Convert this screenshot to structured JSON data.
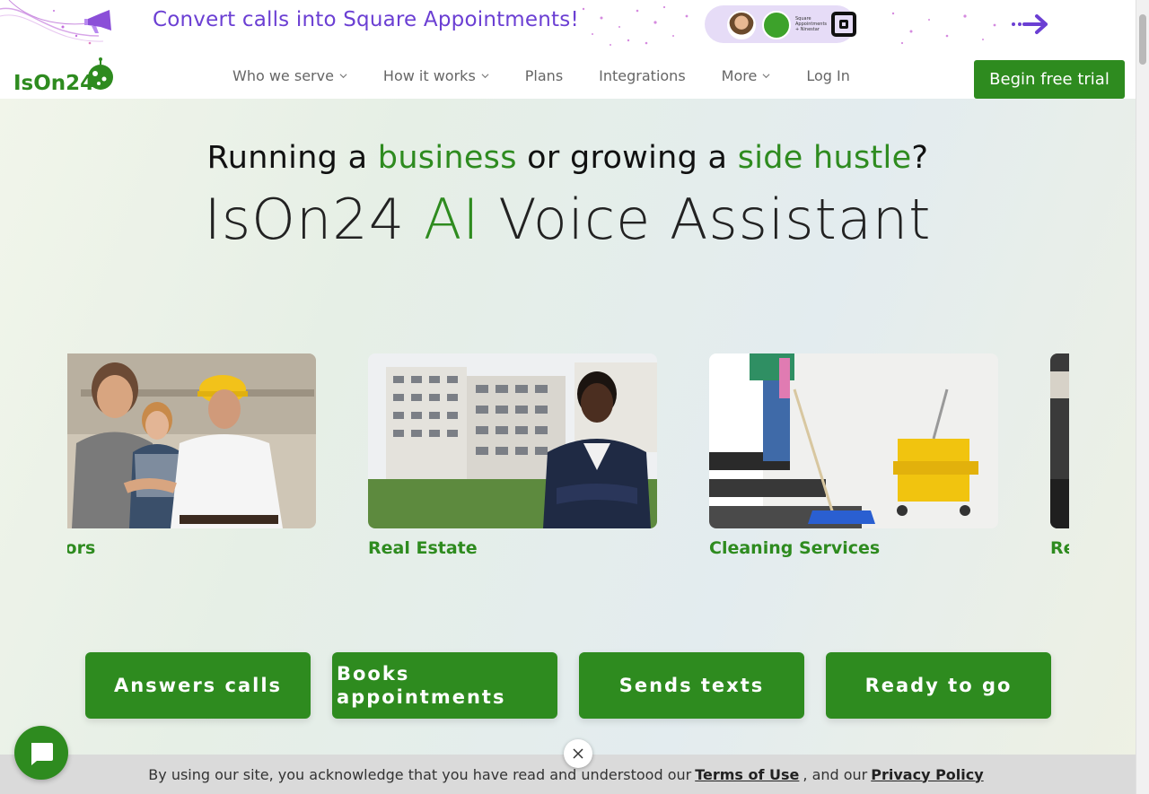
{
  "promo": {
    "text": "Convert calls into Square Appointments!",
    "mini_logo_text": "Square Appointments + Ninestar",
    "icons": [
      "megaphone-icon",
      "avatar",
      "ison24-icon",
      "square-logo-icon",
      "arrow-right-icon"
    ]
  },
  "header": {
    "logo_text": "IsOn24",
    "nav": [
      {
        "label": "Who we serve",
        "dropdown": true
      },
      {
        "label": "How it works",
        "dropdown": true
      },
      {
        "label": "Plans",
        "dropdown": false
      },
      {
        "label": "Integrations",
        "dropdown": false
      },
      {
        "label": "More",
        "dropdown": true
      },
      {
        "label": "Log In",
        "dropdown": false
      }
    ],
    "cta": "Begin free trial"
  },
  "hero": {
    "headline": {
      "part1": "Running a ",
      "green1": "business",
      "part2": " or growing a ",
      "green2": "side hustle",
      "part3": "?"
    },
    "title": {
      "part1": "IsOn24 ",
      "green": "AI",
      "part2": " Voice Assistant"
    }
  },
  "carousel": {
    "cards": [
      {
        "label": "ractors"
      },
      {
        "label": "Real Estate"
      },
      {
        "label": "Cleaning Services"
      },
      {
        "label": "Re"
      }
    ]
  },
  "features": [
    "Answers calls",
    "Books appointments",
    "Sends texts",
    "Ready to go"
  ],
  "cookie": {
    "text_before": "By using our site, you acknowledge that you have read and understood our ",
    "terms": "Terms of Use",
    "text_mid": " , and our ",
    "privacy": "Privacy Policy"
  },
  "colors": {
    "brand_green": "#2e8b1f",
    "promo_purple": "#6b3fd3",
    "cookie_bar": "#dadada"
  }
}
